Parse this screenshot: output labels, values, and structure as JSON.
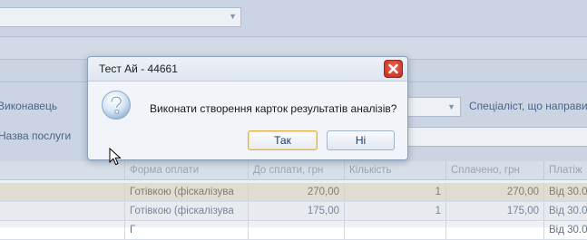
{
  "form": {
    "executor_label": "Виконавець",
    "service_name_label": "Назва послуги",
    "referring_specialist_label": "Спеціаліст, що направив"
  },
  "grid": {
    "headers": [
      "Форма оплати",
      "До сплати, грн",
      "Кількість",
      "Сплачено, грн",
      "Платіж"
    ],
    "rows": [
      {
        "payment_form": "Готівкою (фіскалізува",
        "to_pay": "270,00",
        "quantity": "1",
        "paid": "270,00",
        "payment": "Від 30.0"
      },
      {
        "payment_form": "Готівкою (фіскалізува",
        "to_pay": "175,00",
        "quantity": "1",
        "paid": "175,00",
        "payment": "Від 30.0"
      },
      {
        "payment_form": "Г",
        "to_pay": "",
        "quantity": "",
        "paid": "",
        "payment": "Від 30.0"
      }
    ]
  },
  "dialog": {
    "title": "Тест Ай - 44661",
    "message": "Виконати створення карток результатів аналізів?",
    "yes_label": "Так",
    "no_label": "Ні"
  },
  "icons": {
    "close": "close-icon",
    "question": "question-icon",
    "cursor": "mouse-cursor-icon"
  },
  "colors": {
    "selected_row": "#ece4cf",
    "close_button": "#d43a2b",
    "default_button_border": "#e2b04a"
  }
}
